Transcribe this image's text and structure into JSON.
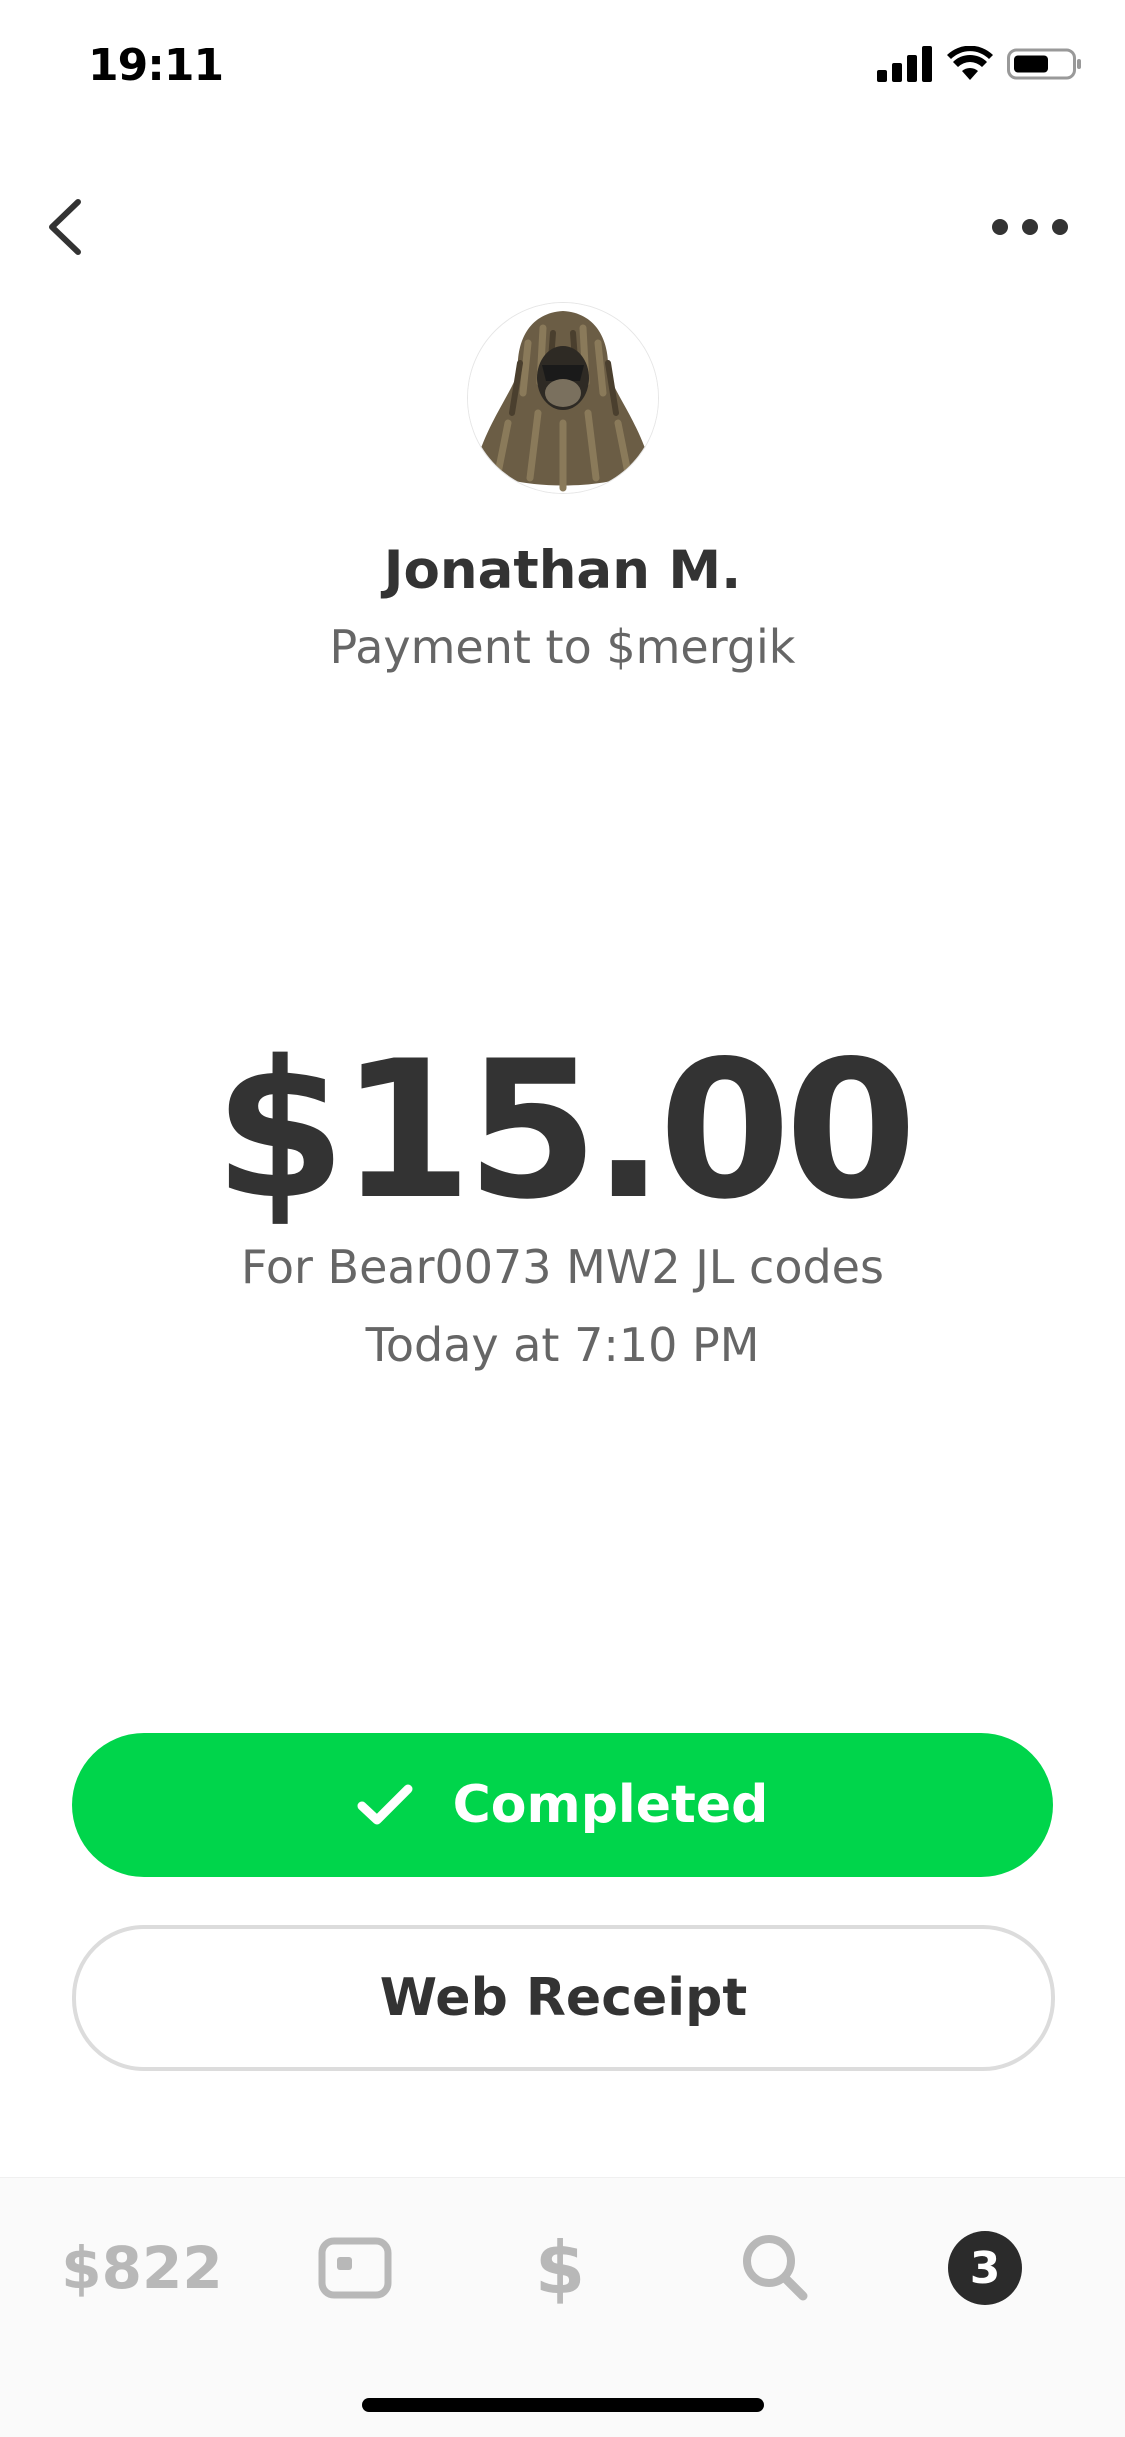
{
  "status_bar": {
    "time": "19:11",
    "icons": [
      "cellular-signal-icon",
      "wifi-icon",
      "battery-icon"
    ]
  },
  "nav": {
    "back_icon": "chevron-left-icon",
    "more_icon": "more-horizontal-icon"
  },
  "profile": {
    "name": "Jonathan M.",
    "subtitle": "Payment to $mergik"
  },
  "payment": {
    "amount": "$15.00",
    "note": "For Bear0073 MW2 JL codes",
    "time": "Today at 7:10 PM"
  },
  "actions": {
    "completed_label": "Completed",
    "web_receipt_label": "Web Receipt"
  },
  "tab_bar": {
    "balance": "$822",
    "cash_symbol": "$",
    "activity_badge": "3"
  },
  "colors": {
    "brand_green": "#00d54b",
    "text_dark": "#333333",
    "text_muted": "#666666",
    "tab_inactive": "#b8b8b8"
  }
}
